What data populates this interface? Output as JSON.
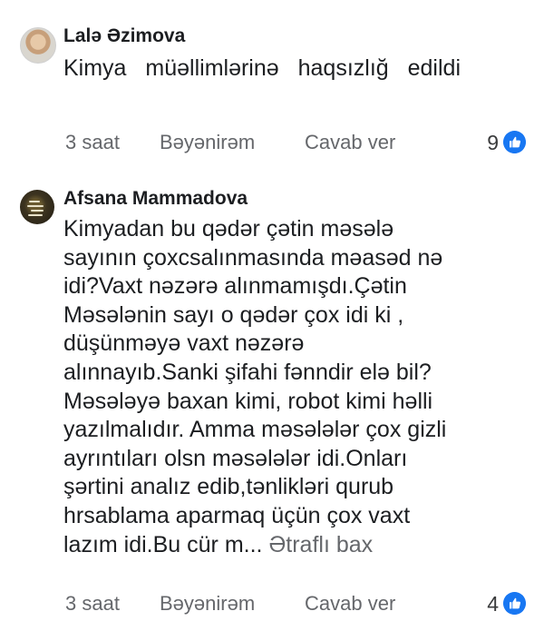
{
  "comments": [
    {
      "author": "Lalə Əzimova",
      "text": "Kimya müəllimlərinə haqsızlığ edildi",
      "time": "3 saat",
      "like_label": "Bəyənirəm",
      "reply_label": "Cavab ver",
      "reaction_count": "9",
      "reaction_icon": "like-icon"
    },
    {
      "author": "Afsana Mammadova",
      "text_lines": [
        "Kimyadan bu qədər çətin məsələ",
        "sayının çoxcsalınmasında məasəd nə",
        "idi?Vaxt nəzərə alınmamışdı.Çətin",
        "Məsələnin sayı o qədər çox idi ki ,",
        "düşünməyə vaxt nəzərə",
        "alınnayıb.Sanki şifahi fənndir elə bil?",
        "Məsələyə baxan kimi, robot kimi həlli",
        "yazılmalıdır. Amma məsələlər çox gizli",
        "ayrıntıları olsn məsələlər idi.Onları",
        "şərtini analız edib,tənlikləri qurub",
        "hrsablama aparmaq üçün çox vaxt",
        "lazım idi.Bu cür m..."
      ],
      "see_more_label": "Ətraflı bax",
      "time": "3 saat",
      "like_label": "Bəyənirəm",
      "reply_label": "Cavab ver",
      "reaction_count": "4",
      "reaction_icon": "like-icon"
    }
  ],
  "colors": {
    "text": "#1c1e21",
    "meta": "#65676b",
    "like_blue": "#0866ff"
  }
}
